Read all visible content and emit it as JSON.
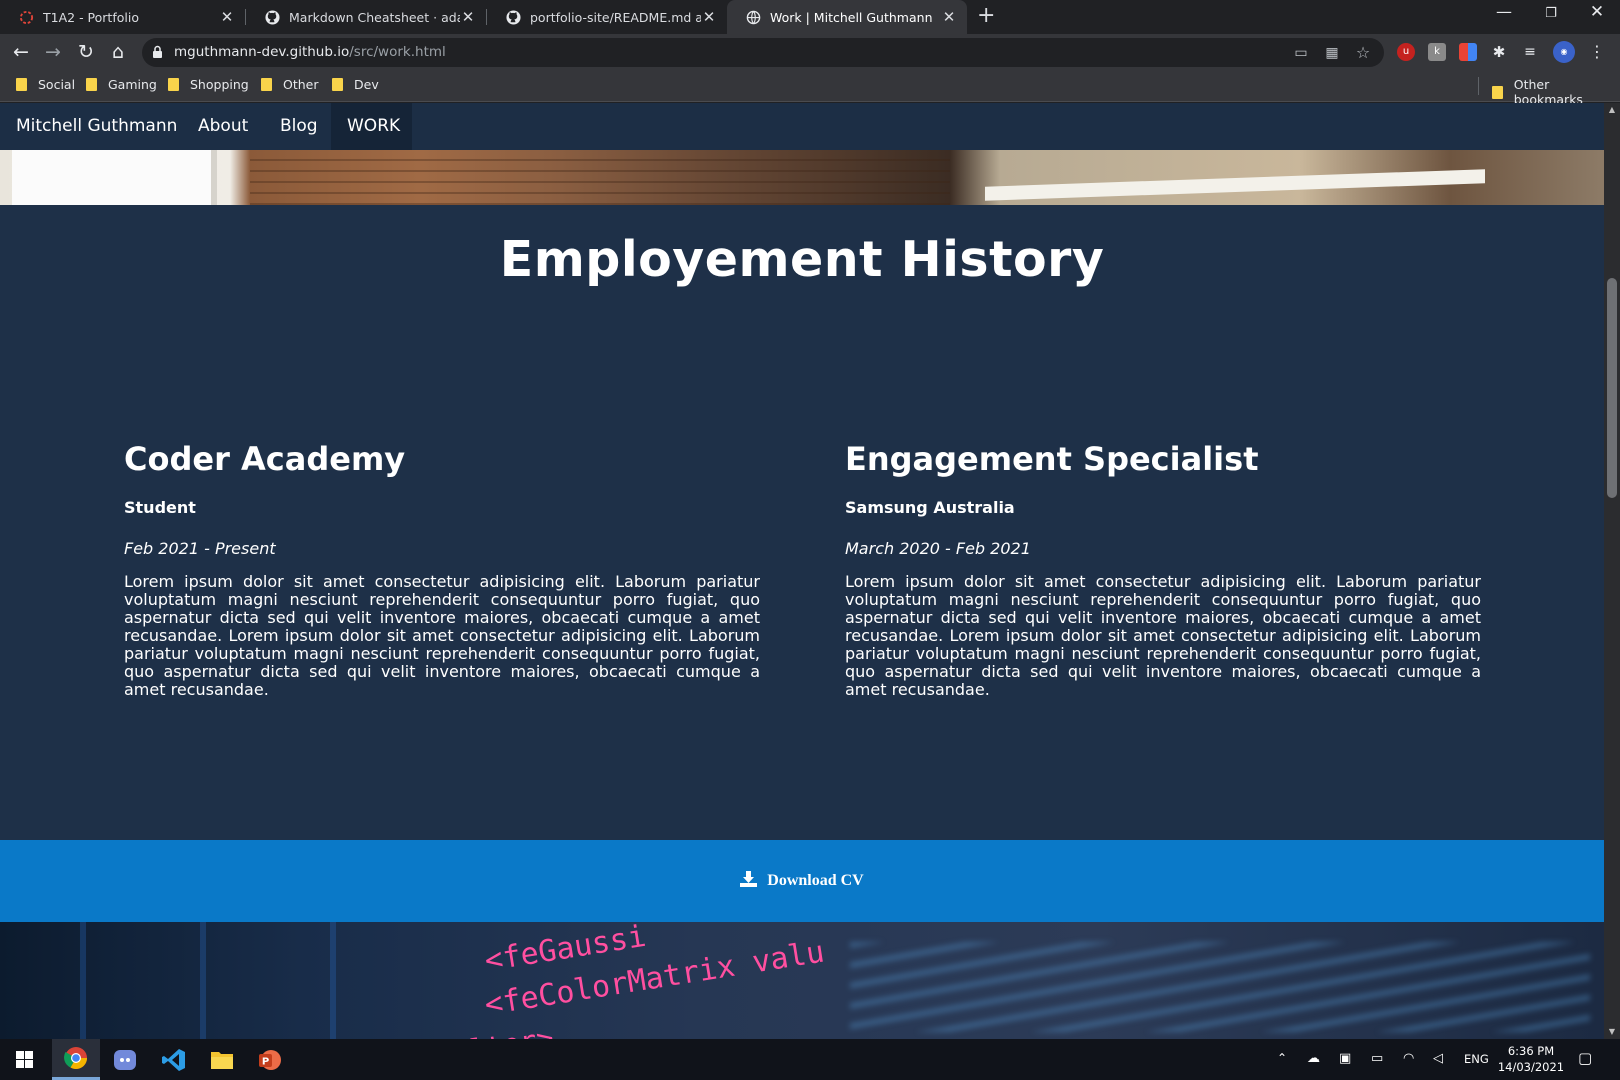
{
  "browser": {
    "tabs": [
      {
        "title": "T1A2 - Portfolio",
        "icon": "loading-icon",
        "active": false
      },
      {
        "title": "Markdown Cheatsheet · adam-p/",
        "icon": "github-icon",
        "active": false
      },
      {
        "title": "portfolio-site/README.md at ma",
        "icon": "github-icon",
        "active": false
      },
      {
        "title": "Work | Mitchell Guthmann",
        "icon": "globe-icon",
        "active": true
      }
    ],
    "url_host": "mguthmann-dev.github.io",
    "url_path": "/src/work.html",
    "bookmarks": [
      "Social",
      "Gaming",
      "Shopping",
      "Other",
      "Dev"
    ],
    "other_bookmarks": "Other bookmarks"
  },
  "site": {
    "nav": {
      "brand": "Mitchell Guthmann",
      "items": [
        "About",
        "Blog",
        "WORK"
      ],
      "active_item": "WORK"
    },
    "title": "Employement History",
    "jobs": [
      {
        "company": "Coder Academy",
        "role": "Student",
        "dates": "Feb 2021 - Present",
        "description": "Lorem ipsum dolor sit amet consectetur adipisicing elit. Laborum pariatur voluptatum magni nesciunt reprehenderit consequuntur porro fugiat, quo aspernatur dicta sed qui velit inventore maiores, obcaecati cumque a amet recusandae. Lorem ipsum dolor sit amet consectetur adipisicing elit. Laborum pariatur voluptatum magni nesciunt reprehenderit consequuntur porro fugiat, quo aspernatur dicta sed qui velit inventore maiores, obcaecati cumque a amet recusandae."
      },
      {
        "company": "Engagement Specialist",
        "role": "Samsung Australia",
        "dates": "March 2020 - Feb 2021",
        "description": "Lorem ipsum dolor sit amet consectetur adipisicing elit. Laborum pariatur voluptatum magni nesciunt reprehenderit consequuntur porro fugiat, quo aspernatur dicta sed qui velit inventore maiores, obcaecati cumque a amet recusandae. Lorem ipsum dolor sit amet consectetur adipisicing elit. Laborum pariatur voluptatum magni nesciunt reprehenderit consequuntur porro fugiat, quo aspernatur dicta sed qui velit inventore maiores, obcaecati cumque a amet recusandae."
      }
    ],
    "download_cv": "Download CV",
    "code_image_lines": [
      "<feGaussi",
      "<feColorMatrix valu",
      "lter>"
    ]
  },
  "taskbar": {
    "apps": [
      "start-icon",
      "chrome-icon",
      "discord-icon",
      "vscode-icon",
      "file-explorer-icon",
      "powerpoint-icon"
    ],
    "language": "ENG",
    "time": "6:36 PM",
    "date": "14/03/2021"
  },
  "colors": {
    "page_bg": "#1e3048",
    "nav_bg": "#1c2e45",
    "cv_bar": "#0a79c8",
    "code_pink": "#ff4fa0"
  }
}
